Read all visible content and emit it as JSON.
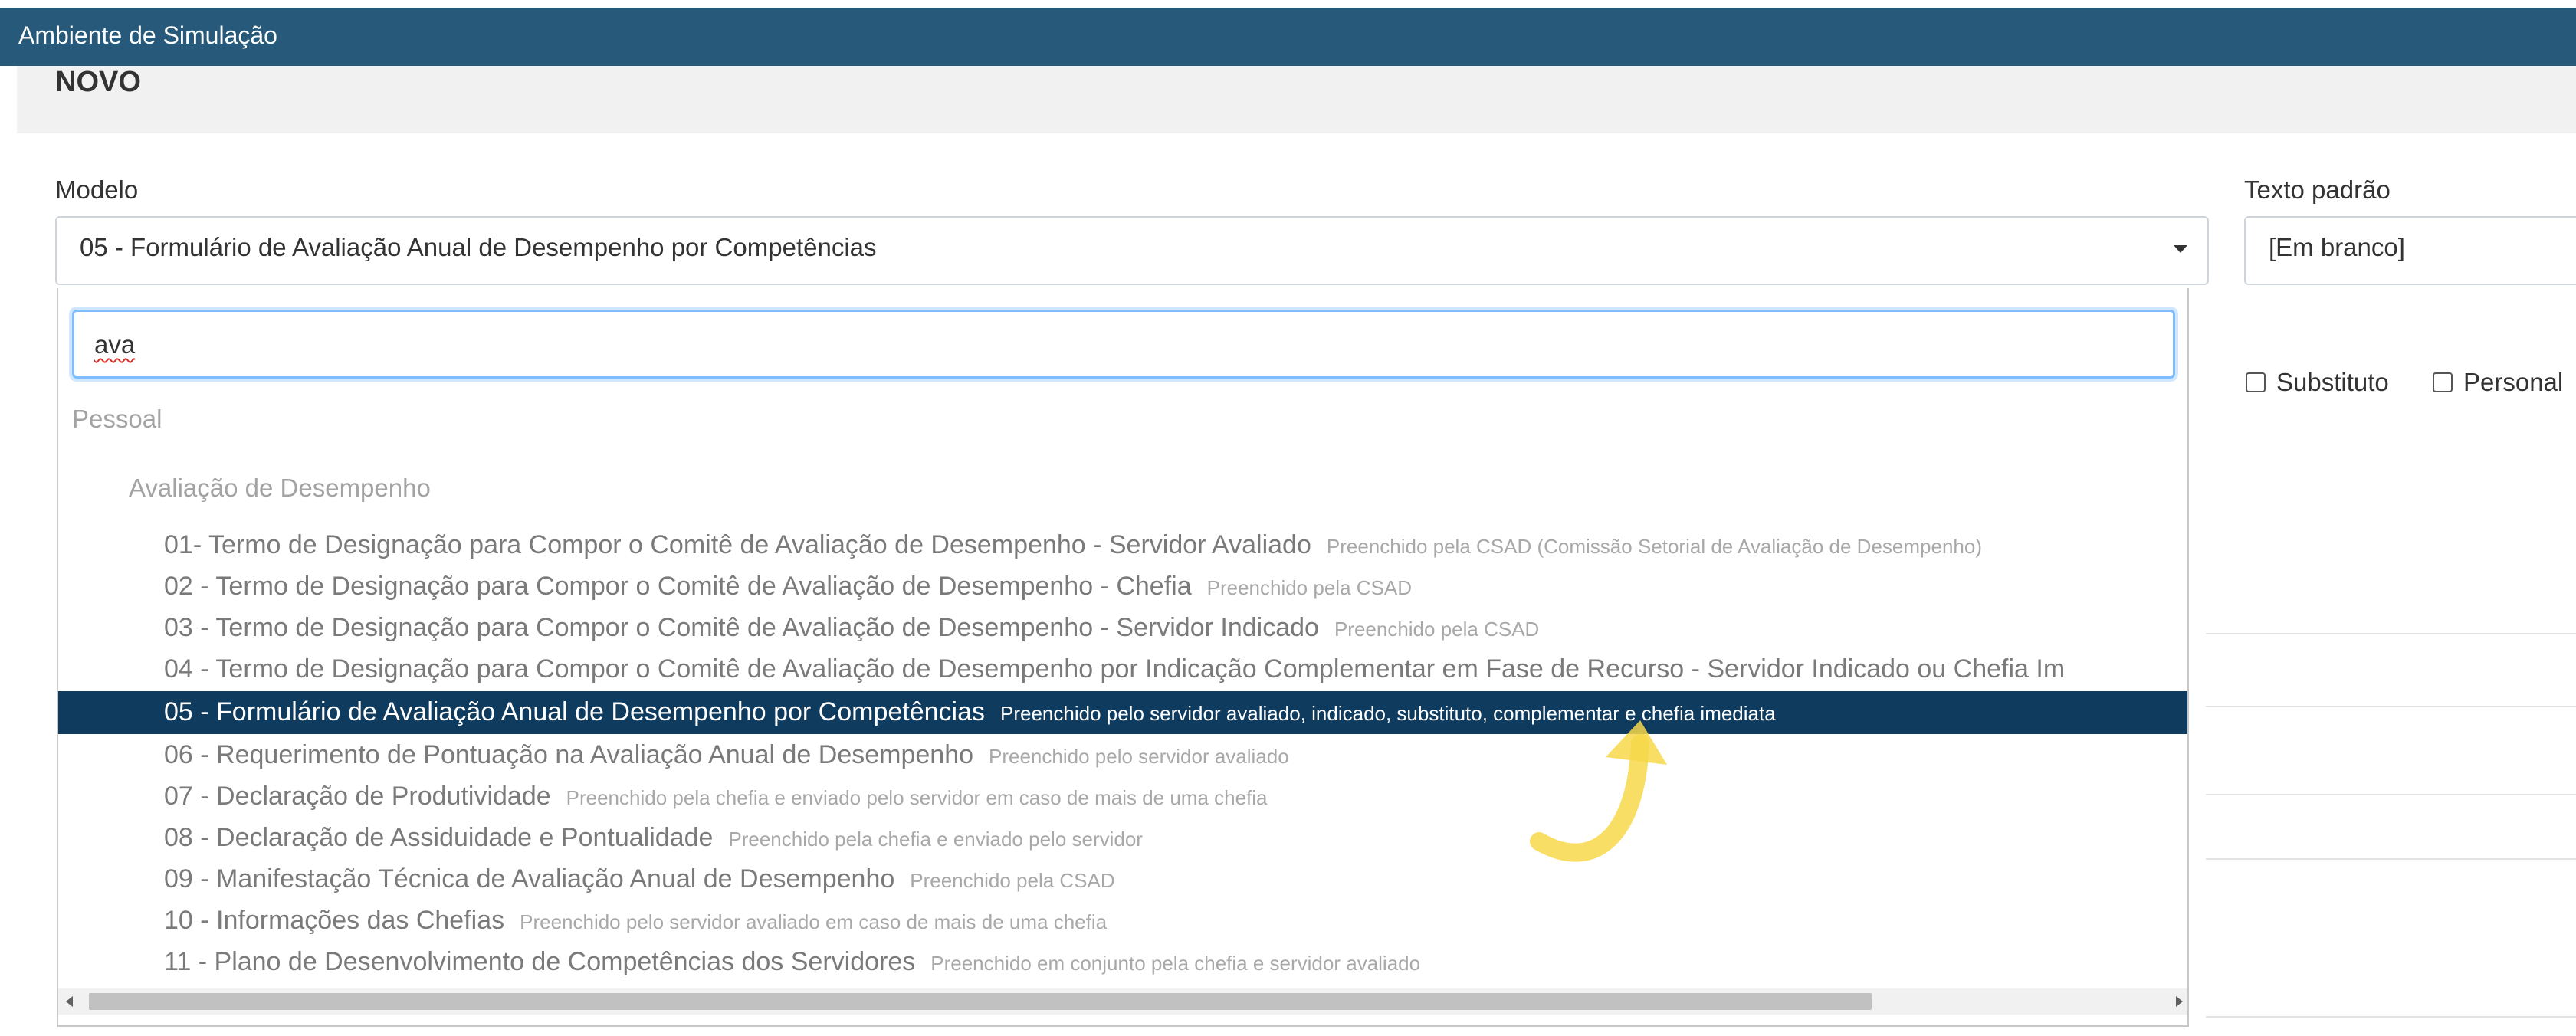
{
  "window": {
    "title": "Ambiente de Simulação"
  },
  "page": {
    "heading": "NOVO"
  },
  "form": {
    "modelo_label": "Modelo",
    "modelo_value": "05 - Formulário de Avaliação Anual de Desempenho por Competências",
    "texto_padrao_label": "Texto padrão",
    "texto_padrao_value": "[Em branco]",
    "checkbox_substituto": "Substituto",
    "checkbox_personal": "Personal"
  },
  "dropdown": {
    "search_value": "ava",
    "group": "Pessoal",
    "subgroup": "Avaliação de Desempenho",
    "options": [
      {
        "name": "01- Termo de Designação para Compor o Comitê de Avaliação de Desempenho - Servidor Avaliado",
        "hint": "Preenchido pela CSAD (Comissão Setorial de Avaliação de Desempenho)"
      },
      {
        "name": "02 - Termo de Designação para Compor o Comitê de Avaliação de Desempenho - Chefia",
        "hint": "Preenchido pela CSAD"
      },
      {
        "name": "03 - Termo de Designação para Compor o Comitê de Avaliação de Desempenho - Servidor Indicado",
        "hint": "Preenchido pela CSAD"
      },
      {
        "name": "04 - Termo de Designação para Compor o Comitê de Avaliação de Desempenho por Indicação Complementar em Fase de Recurso - Servidor Indicado ou Chefia Im",
        "hint": ""
      },
      {
        "name": "05 - Formulário de Avaliação Anual de Desempenho por Competências",
        "hint": "Preenchido pelo servidor avaliado, indicado, substituto, complementar e chefia imediata"
      },
      {
        "name": "06 - Requerimento de Pontuação na Avaliação Anual de Desempenho",
        "hint": "Preenchido pelo servidor avaliado"
      },
      {
        "name": "07 - Declaração de Produtividade",
        "hint": "Preenchido pela chefia e enviado pelo servidor em caso de mais de uma chefia"
      },
      {
        "name": "08 - Declaração de Assiduidade e Pontualidade",
        "hint": "Preenchido pela chefia e enviado pelo servidor"
      },
      {
        "name": "09 - Manifestação Técnica de Avaliação Anual de Desempenho",
        "hint": "Preenchido pela CSAD"
      },
      {
        "name": "10 - Informações das Chefias",
        "hint": "Preenchido pelo servidor avaliado em caso de mais de uma chefia"
      },
      {
        "name": "11 - Plano de Desenvolvimento de Competências dos Servidores",
        "hint": "Preenchido em conjunto pela chefia e servidor avaliado"
      }
    ],
    "selected_index": 4
  },
  "colors": {
    "titlebar": "#275a7a",
    "selected_row": "#0f3b5f",
    "focus_border": "#80bdff",
    "annotation_arrow": "#f7d84a"
  }
}
